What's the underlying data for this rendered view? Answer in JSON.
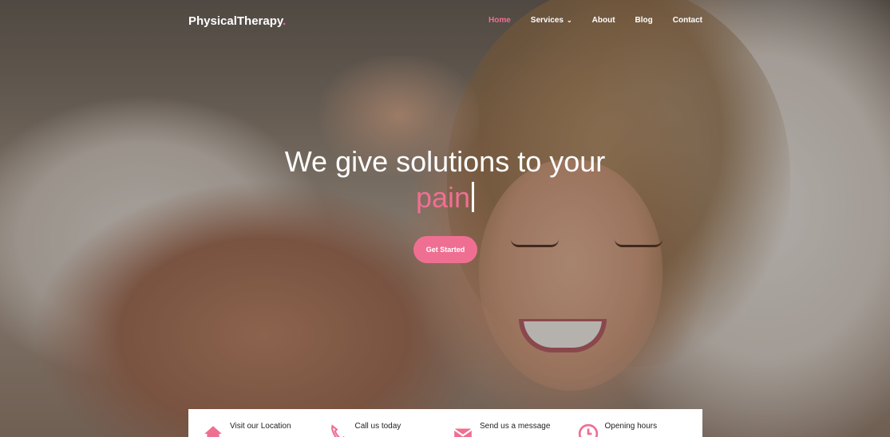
{
  "brand": {
    "name": "PhysicalTherapy",
    "dot": "."
  },
  "nav": {
    "items": [
      {
        "label": "Home",
        "active": true
      },
      {
        "label": "Services",
        "dropdown": true
      },
      {
        "label": "About"
      },
      {
        "label": "Blog"
      },
      {
        "label": "Contact"
      }
    ]
  },
  "hero": {
    "headline_line1": "We give solutions to your",
    "headline_accent": "pain",
    "cta_label": "Get Started"
  },
  "info": [
    {
      "label": "Visit our Location",
      "icon": "home-icon"
    },
    {
      "label": "Call us today",
      "icon": "phone-icon"
    },
    {
      "label": "Send us a message",
      "icon": "mail-icon"
    },
    {
      "label": "Opening hours",
      "icon": "clock-icon"
    }
  ],
  "colors": {
    "accent": "#ef6f93",
    "text": "#ffffff",
    "infobar_bg": "#ffffff"
  }
}
